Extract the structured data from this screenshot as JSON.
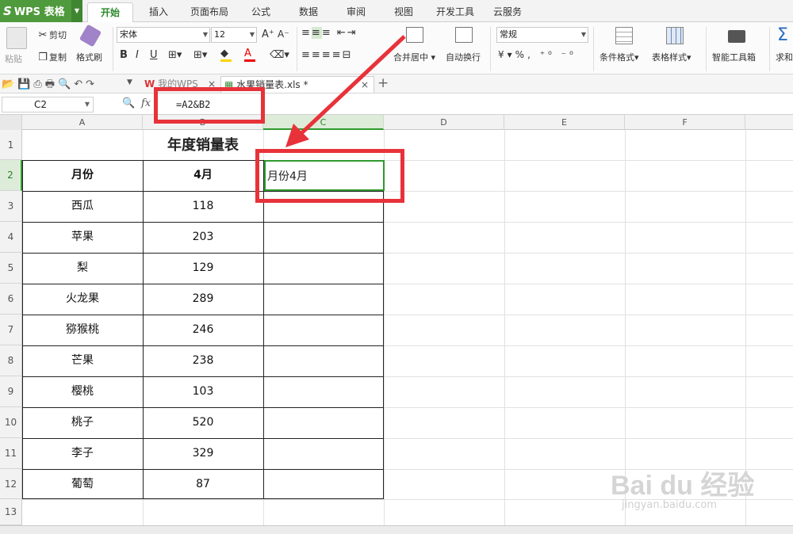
{
  "app": {
    "brand": "WPS 表格"
  },
  "menu": [
    "开始",
    "插入",
    "页面布局",
    "公式",
    "数据",
    "审阅",
    "视图",
    "开发工具",
    "云服务"
  ],
  "ribbon": {
    "paste": "粘贴",
    "cut": "剪切",
    "copy": "复制",
    "format_painter": "格式刷",
    "font_name": "宋体",
    "font_size": "12",
    "merge": "合并居中",
    "wrap": "自动换行",
    "number_format": "常规",
    "cond_format": "条件格式",
    "table_style": "表格样式",
    "smart_tools": "智能工具箱",
    "sum": "求和"
  },
  "doc_tabs": [
    {
      "name": "我的WPS"
    },
    {
      "name": "水果销量表.xls *"
    }
  ],
  "formula_bar": {
    "cell_ref": "C2",
    "fx": "fx",
    "formula": "=A2&B2"
  },
  "columns": [
    "A",
    "B",
    "C",
    "D",
    "E",
    "F"
  ],
  "rows": [
    "1",
    "2",
    "3",
    "4",
    "5",
    "6",
    "7",
    "8",
    "9",
    "10",
    "11",
    "12",
    "13"
  ],
  "sheet": {
    "title": "年度销量表",
    "header": {
      "a": "月份",
      "b": "4月",
      "c": "月份4月"
    },
    "data": [
      {
        "fruit": "西瓜",
        "value": "118"
      },
      {
        "fruit": "苹果",
        "value": "203"
      },
      {
        "fruit": "梨",
        "value": "129"
      },
      {
        "fruit": "火龙果",
        "value": "289"
      },
      {
        "fruit": "猕猴桃",
        "value": "246"
      },
      {
        "fruit": "芒果",
        "value": "238"
      },
      {
        "fruit": "樱桃",
        "value": "103"
      },
      {
        "fruit": "桃子",
        "value": "520"
      },
      {
        "fruit": "李子",
        "value": "329"
      },
      {
        "fruit": "葡萄",
        "value": "87"
      }
    ]
  },
  "watermark": {
    "brand": "Bai du 经验",
    "url": "jingyan.baidu.com"
  },
  "colors": {
    "accent_green": "#4f9a3c",
    "annotation_red": "#e8323a",
    "selection_green": "#2e9a2e"
  }
}
